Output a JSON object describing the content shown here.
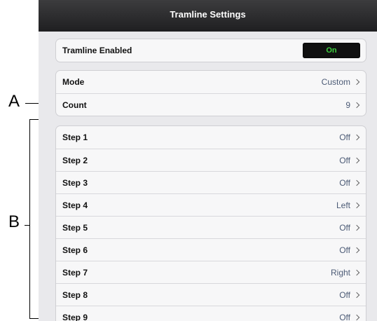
{
  "title": "Tramline Settings",
  "enabled": {
    "label": "Tramline Enabled",
    "value": "On"
  },
  "mode_group": [
    {
      "label": "Mode",
      "value": "Custom"
    },
    {
      "label": "Count",
      "value": "9"
    }
  ],
  "steps": [
    {
      "label": "Step 1",
      "value": "Off"
    },
    {
      "label": "Step 2",
      "value": "Off"
    },
    {
      "label": "Step 3",
      "value": "Off"
    },
    {
      "label": "Step 4",
      "value": "Left"
    },
    {
      "label": "Step 5",
      "value": "Off"
    },
    {
      "label": "Step 6",
      "value": "Off"
    },
    {
      "label": "Step 7",
      "value": "Right"
    },
    {
      "label": "Step 8",
      "value": "Off"
    },
    {
      "label": "Step 9",
      "value": "Off"
    }
  ],
  "annotations": {
    "a": "A",
    "b": "B"
  }
}
